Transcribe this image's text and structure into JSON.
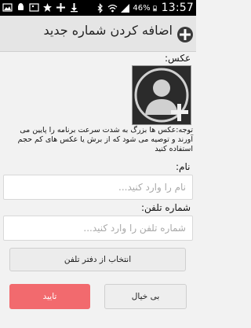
{
  "status_bar": {
    "battery": "46%",
    "time": "13:57"
  },
  "header": {
    "title": "اضافه کردن شماره جدید",
    "add_icon": "plus-circle-icon"
  },
  "form": {
    "photo_label": "عکس:",
    "photo_note": "توجه:عکس ها بزرگ به شدت سرعت برنامه را پایین می آورند و توصیه می شود که از برش یا عکس های کم حجم استفاده کنید",
    "name_label": "نام:",
    "name_placeholder": "نام را وارد کنید...",
    "phone_label": "شماره تلفن:",
    "phone_placeholder": "شماره تلفن را وارد کنید...",
    "import_button": "انتخاب از دفتر تلفن"
  },
  "actions": {
    "confirm": "تایید",
    "cancel": "بی خیال"
  },
  "colors": {
    "confirm_bg": "#f26a6e",
    "titlebar_bg": "#e5e5e5",
    "page_bg": "#f2f2f2"
  }
}
